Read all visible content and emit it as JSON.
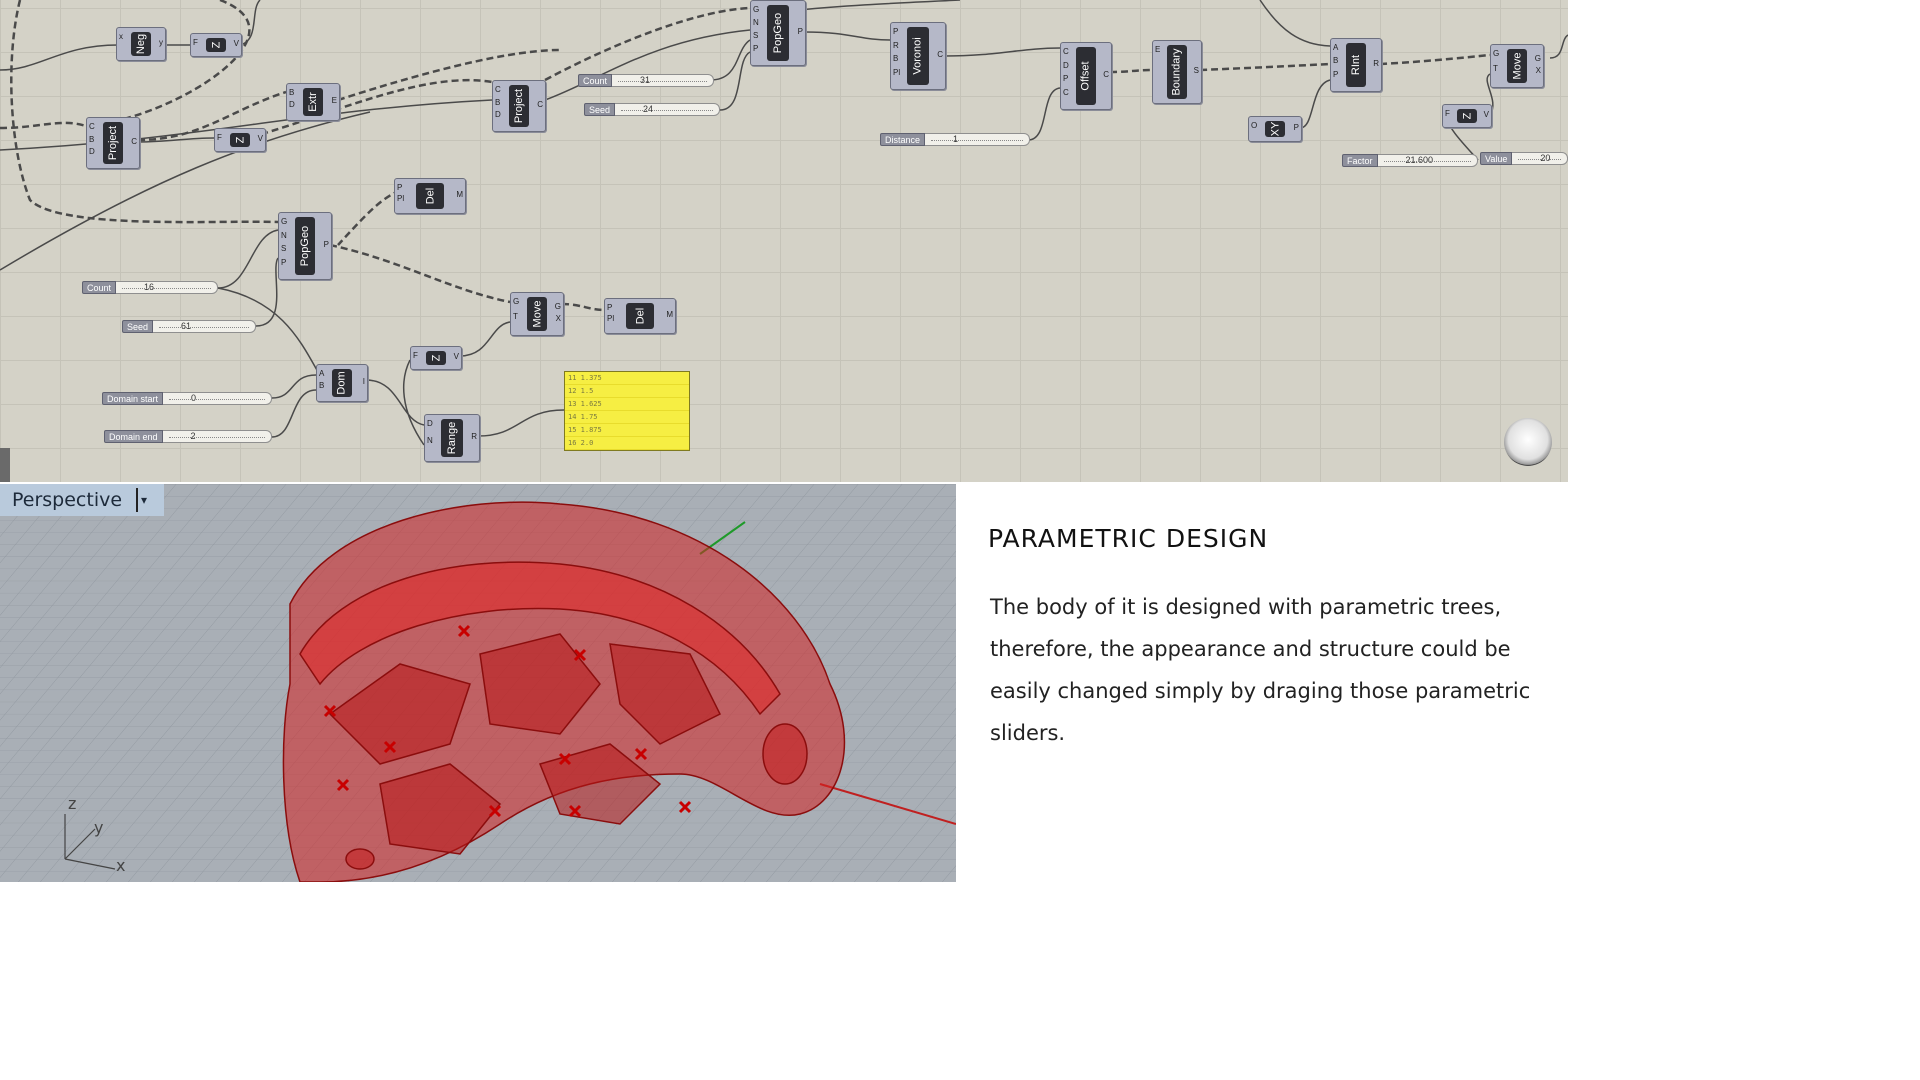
{
  "canvas": {
    "components": [
      {
        "key": "neg",
        "name": "Neg",
        "in": [
          "x"
        ],
        "out": [
          "y"
        ]
      },
      {
        "key": "z1",
        "name": "Z",
        "in": [
          "F"
        ],
        "out": [
          "V"
        ]
      },
      {
        "key": "project1",
        "name": "Project",
        "in": [
          "C",
          "B",
          "D"
        ],
        "out": [
          "C"
        ]
      },
      {
        "key": "extr",
        "name": "Extr",
        "in": [
          "B",
          "D"
        ],
        "out": [
          "E"
        ]
      },
      {
        "key": "z2",
        "name": "Z",
        "in": [
          "F"
        ],
        "out": [
          "V"
        ]
      },
      {
        "key": "project2",
        "name": "Project",
        "in": [
          "C",
          "B",
          "D"
        ],
        "out": [
          "C"
        ]
      },
      {
        "key": "popgeo1",
        "name": "PopGeo",
        "in": [
          "G",
          "N",
          "S",
          "P"
        ],
        "out": [
          "P"
        ]
      },
      {
        "key": "voronoi",
        "name": "Voronoi",
        "in": [
          "P",
          "R",
          "B",
          "Pl"
        ],
        "out": [
          "C"
        ]
      },
      {
        "key": "offset",
        "name": "Offset",
        "in": [
          "C",
          "D",
          "P",
          "C"
        ],
        "out": [
          "C"
        ]
      },
      {
        "key": "boundary",
        "name": "Boundary",
        "in": [
          "E"
        ],
        "out": [
          "S"
        ]
      },
      {
        "key": "rint",
        "name": "RInt",
        "in": [
          "A",
          "B",
          "P"
        ],
        "out": [
          "R"
        ]
      },
      {
        "key": "xy",
        "name": "XY",
        "in": [
          "O"
        ],
        "out": [
          "P"
        ]
      },
      {
        "key": "z3",
        "name": "Z",
        "in": [
          "F"
        ],
        "out": [
          "V"
        ]
      },
      {
        "key": "move1",
        "name": "Move",
        "in": [
          "G",
          "T"
        ],
        "out": [
          "G",
          "X"
        ]
      },
      {
        "key": "del1",
        "name": "Del",
        "in": [
          "P",
          "Pl"
        ],
        "out": [
          "M"
        ]
      },
      {
        "key": "popgeo2",
        "name": "PopGeo",
        "in": [
          "G",
          "N",
          "S",
          "P"
        ],
        "out": [
          "P"
        ]
      },
      {
        "key": "move2",
        "name": "Move",
        "in": [
          "G",
          "T"
        ],
        "out": [
          "G",
          "X"
        ]
      },
      {
        "key": "del2",
        "name": "Del",
        "in": [
          "P",
          "Pl"
        ],
        "out": [
          "M"
        ]
      },
      {
        "key": "z4",
        "name": "Z",
        "in": [
          "F"
        ],
        "out": [
          "V"
        ]
      },
      {
        "key": "dom",
        "name": "Dom",
        "in": [
          "A",
          "B"
        ],
        "out": [
          "I"
        ]
      },
      {
        "key": "range",
        "name": "Range",
        "in": [
          "D",
          "N"
        ],
        "out": [
          "R"
        ]
      }
    ],
    "sliders": [
      {
        "key": "count1",
        "label": "Count",
        "value": "31"
      },
      {
        "key": "seed1",
        "label": "Seed",
        "value": "24"
      },
      {
        "key": "distance",
        "label": "Distance",
        "value": "1"
      },
      {
        "key": "factor",
        "label": "Factor",
        "value": "21.600"
      },
      {
        "key": "val",
        "label": "Value",
        "value": "20"
      },
      {
        "key": "count2",
        "label": "Count",
        "value": "16"
      },
      {
        "key": "seed2",
        "label": "Seed",
        "value": "61"
      },
      {
        "key": "dstart",
        "label": "Domain start",
        "value": "0"
      },
      {
        "key": "dend",
        "label": "Domain end",
        "value": "2"
      }
    ],
    "panel_rows": [
      "11 1.375",
      "12 1.5",
      "13 1.625",
      "14 1.75",
      "15 1.875",
      "16 2.0"
    ]
  },
  "viewport": {
    "label": "Perspective",
    "dropdown_glyph": "▾",
    "axes": [
      "z",
      "y",
      "x"
    ]
  },
  "description": {
    "heading": "PARAMETRIC DESIGN",
    "body": "The body of it is designed with parametric trees, therefore, the appearance and structure could be easily changed simply by draging those parametric sliders."
  },
  "colors": {
    "canvas_bg": "#d4d2c7",
    "component": "#b5b8c8",
    "panel": "#f6ee43",
    "model_red": "#d42020",
    "viewport_bg": "#a9afb6"
  }
}
